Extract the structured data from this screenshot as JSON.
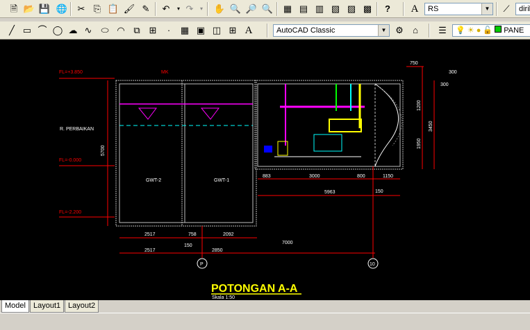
{
  "toolbar1": {
    "text_style_value": "RS",
    "dim_style_value": "dirik"
  },
  "toolbar2": {
    "workspace_value": "AutoCAD Classic",
    "layer_value": "PANE"
  },
  "drawing": {
    "title": "POTONGAN A-A",
    "scale": "Skala 1:50",
    "levels": {
      "top": "FL=+3.850",
      "mid": "FL=-0.000",
      "low": "FL=-2.200"
    },
    "tank_label_left": "GWT-2",
    "tank_label_right": "GWT-1",
    "room_label": "R. PERBAIKAN",
    "vertical_dim": "5700",
    "inlet_label": "MK",
    "dims_bottom_row1": [
      "2517",
      "758",
      "2092"
    ],
    "dims_bottom_row2": [
      "2517",
      "150",
      "2850"
    ],
    "dim_total": "7000",
    "dims_right_row": [
      "883",
      "3000",
      "800",
      "1150"
    ],
    "dim_right_total": "5963",
    "dim_150": "150",
    "dims_top": [
      "750",
      "300",
      "300"
    ],
    "dims_side": [
      "1200",
      "3450",
      "1950"
    ],
    "grid_p": "P",
    "grid_10": "10"
  },
  "tabs": [
    "Model",
    "Layout1",
    "Layout2"
  ],
  "colors": {
    "canvas": "#000000",
    "wall": "#ffffff",
    "dim": "#ff0000",
    "magenta": "#ff00ff",
    "cyan": "#00ffff",
    "yellow": "#ffff00"
  }
}
